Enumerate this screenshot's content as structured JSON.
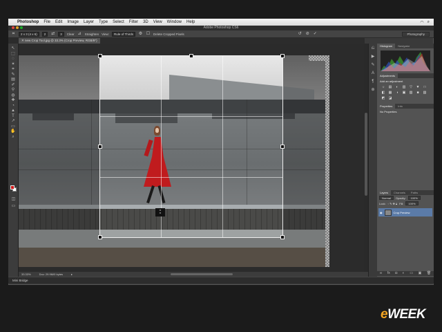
{
  "menubar": {
    "app_name": "Photoshop",
    "items": [
      "File",
      "Edit",
      "Image",
      "Layer",
      "Type",
      "Select",
      "Filter",
      "3D",
      "View",
      "Window",
      "Help"
    ]
  },
  "window": {
    "title": "Adobe Photoshop CS6"
  },
  "options": {
    "ratio": "2 x 3 (4 x 6)",
    "width_val": "2",
    "height_val": "3",
    "clear_label": "Clear",
    "straighten_label": "Straighten",
    "view_label": "View:",
    "view_value": "Rule of Thirds",
    "delete_pixels_label": "Delete Cropped Pixels",
    "workspace": "Photography"
  },
  "document": {
    "tab_label": "new Crop Tool.jpg @ 33.3% (Crop Preview, RGB/8*)"
  },
  "status": {
    "zoom": "33.33%",
    "doc_size": "Doc: 29.9M/0 bytes"
  },
  "mini_bridge": {
    "label": "Mini Bridge"
  },
  "panels": {
    "histogram_tabs": [
      "Histogram",
      "Navigator"
    ],
    "adjustments_tab": "Adjustments",
    "adjustments_title": "Add an adjustment",
    "adjustment_icons": [
      "☼",
      "▤",
      "◐",
      "▥",
      "▽",
      "▼",
      "□",
      "◧",
      "▦",
      "◑",
      "▣",
      "▨",
      "■",
      "▧",
      "◩",
      "◪",
      "▩",
      "◫",
      "◢",
      "◣",
      "▰"
    ],
    "properties_tabs": [
      "Properties",
      "Info"
    ],
    "properties_text": "No Properties",
    "layers_tabs": [
      "Layers",
      "Channels",
      "Paths"
    ],
    "blend_mode": "Normal",
    "opacity_label": "Opacity:",
    "opacity_value": "100%",
    "lock_label": "Lock:",
    "fill_label": "Fill:",
    "fill_value": "100%",
    "layer_name": "Crop Preview"
  },
  "tools": [
    "↖",
    "⬚",
    "◌",
    "✶",
    "⌗",
    "✎",
    "▤",
    "✐",
    "⚲",
    "◍",
    "✚",
    "◔",
    "▲",
    "T",
    "↗",
    "▭",
    "✋",
    "⌕"
  ],
  "colors": {
    "foreground": "#d01818",
    "background": "#ffffff",
    "logo_accent": "#f5a623"
  },
  "logo": {
    "prefix": "e",
    "rest": "WEEK"
  }
}
